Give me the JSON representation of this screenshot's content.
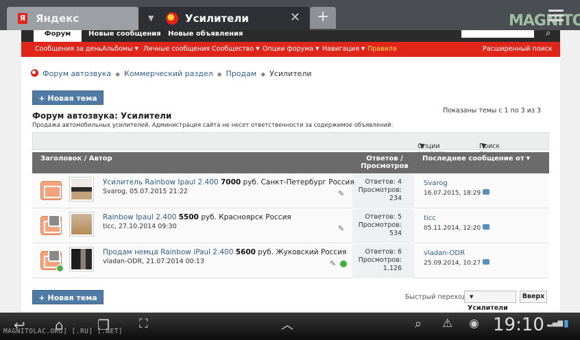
{
  "browser": {
    "tabs": [
      {
        "label": "Яндекс",
        "icon": "yandex-icon"
      },
      {
        "label": "Усилители",
        "icon": "forum-icon",
        "active": true
      }
    ],
    "new_tab": "+",
    "watermark": "MAGNITOL"
  },
  "site": {
    "topnav": [
      "Форум",
      "Новые сообщения",
      "Новые объявления"
    ],
    "rednav": [
      {
        "label": "Сообщения за день",
        "dropdown": false
      },
      {
        "label": "Альбомы",
        "dropdown": true
      },
      {
        "label": "Личные сообщения",
        "dropdown": false
      },
      {
        "label": "Сообщество",
        "dropdown": true
      },
      {
        "label": "Опции форума",
        "dropdown": true
      },
      {
        "label": "Навигация",
        "dropdown": true
      },
      {
        "label": "Правила",
        "dropdown": false,
        "highlight": true
      }
    ],
    "advanced_search": "Расширенный поиск"
  },
  "breadcrumb": [
    "Форум автозвука",
    "Коммерческий раздел",
    "Продам",
    "Усилители"
  ],
  "new_topic_label": "+ Новая тема",
  "forum": {
    "title": "Форум автозвука: Усилители",
    "description": "Продажа автомобильных усилителей. Администрация сайта не несет ответственности за содержимое объявлений.",
    "shown": "Показаны темы с 1 по 3 из 3"
  },
  "options": {
    "section_options": "Опции раздела",
    "search_section": "Поиск по разделу"
  },
  "table": {
    "col_title": "Заголовок / Автор",
    "col_stats": "Ответов / Просмотров",
    "col_last": "Последнее сообщение от",
    "rows": [
      {
        "link": "Усилитель Rainbow Ipaul 2.400",
        "price": "7000",
        "rest": "руб. Санкт-Петербург Россия",
        "author_date": "Svarog, 05.07.2015 21:22",
        "replies": "Ответов: 4",
        "views_label": "Просмотров:",
        "views": "234",
        "last_user": "Svarog",
        "last_date": "16.07.2015, 18:29"
      },
      {
        "link": "Rainbow Ipaul 2.400",
        "price": "5500",
        "rest": "руб. Красноярск Россия",
        "author_date": "ticc, 27.10.2014 09:30",
        "replies": "Ответов: 5",
        "views_label": "Просмотров:",
        "views": "534",
        "last_user": "ticc",
        "last_date": "05.11.2014, 12:20"
      },
      {
        "link": "Продам немца Rainbow iPaul 2.400",
        "price": "5600",
        "rest": "руб. Жуковский Россия",
        "author_date": "vladan-ODR, 21.07.2014 00:13",
        "replies": "Ответов: 6",
        "views_label": "Просмотров:",
        "views": "1,126",
        "last_user": "vladan-ODR",
        "last_date": "25.09.2014, 10:27"
      }
    ]
  },
  "quick_nav": {
    "label": "Быстрый переход",
    "selected": "Усилители",
    "go": "Вверх"
  },
  "system": {
    "clock": "19:10",
    "credit": "MAGNITOLAC.ORG] [.RU] [.NET]"
  }
}
